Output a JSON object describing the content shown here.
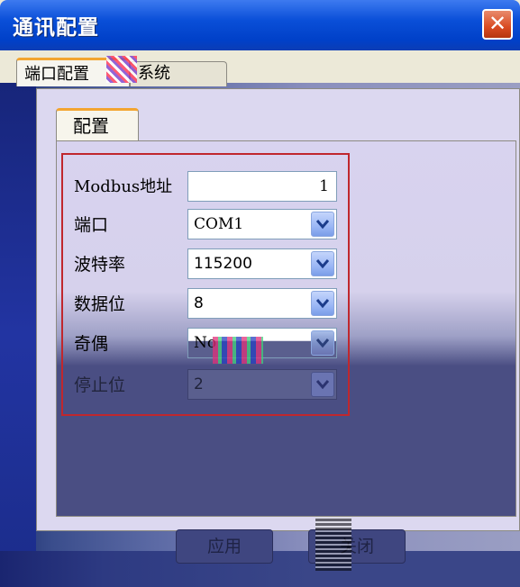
{
  "window": {
    "title": "通讯配置",
    "close_glyph": "✕"
  },
  "outer_tabs": [
    {
      "label": "端口配置"
    },
    {
      "label": "系统"
    }
  ],
  "inner_tab": {
    "label": "配置"
  },
  "form": {
    "modbus_label": "Modbus地址",
    "modbus_value": "1",
    "port_label": "端口",
    "port_value": "COM1",
    "baud_label": "波特率",
    "baud_value": "115200",
    "databits_label": "数据位",
    "databits_value": "8",
    "parity_label": "奇偶",
    "parity_value": "No",
    "stopbits_label": "停止位",
    "stopbits_value": "2"
  },
  "buttons": {
    "apply_label": "应用",
    "close_label": "关闭"
  },
  "colors": {
    "accent_tab": "#f3a530",
    "highlight_box": "#c0272d",
    "titlebar": "#0a4fd8"
  }
}
